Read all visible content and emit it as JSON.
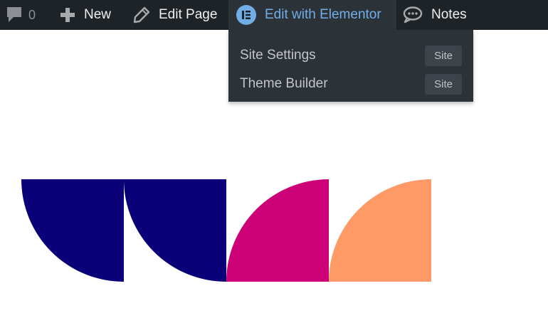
{
  "adminbar": {
    "comments": {
      "icon": "comment-bubble-icon",
      "count": "0"
    },
    "new": {
      "icon": "plus-icon",
      "label": "New"
    },
    "edit_page": {
      "icon": "pencil-icon",
      "label": "Edit Page"
    },
    "elementor": {
      "icon": "elementor-icon",
      "label": "Edit with Elementor"
    },
    "notes": {
      "icon": "speech-bubble-icon",
      "label": "Notes"
    }
  },
  "dropdown": {
    "items": [
      {
        "label": "Site Settings",
        "badge": "Site"
      },
      {
        "label": "Theme Builder",
        "badge": "Site"
      }
    ]
  },
  "colors": {
    "adminbar_bg": "#1d2327",
    "dropdown_bg": "#2c3338",
    "elementor_blue": "#72aee6",
    "shape_navy": "#0a0077",
    "shape_magenta": "#cc0077",
    "shape_orange": "#ff9966"
  }
}
